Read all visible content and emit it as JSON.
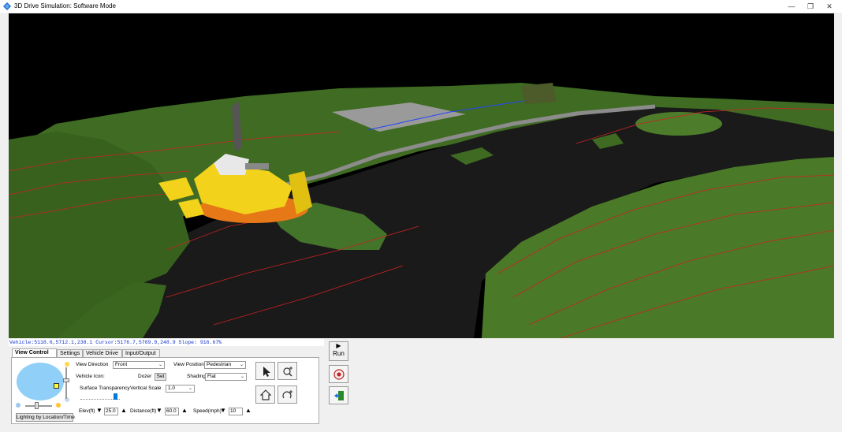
{
  "window": {
    "title": "3D Drive Simulation: Software Mode",
    "controls": {
      "minimize": "—",
      "restore": "❐",
      "close": "✕"
    }
  },
  "status": {
    "line": "Vehicle:5118.6,5712.1,238.1  Cursor:5176.7,5769.9,248.9 Slope: 916.67%"
  },
  "tabs": [
    {
      "label": "View Control",
      "active": true
    },
    {
      "label": "Settings",
      "active": false
    },
    {
      "label": "Vehicle Drive",
      "active": false
    },
    {
      "label": "Input/Output",
      "active": false
    }
  ],
  "view_control": {
    "view_direction_label": "View Direction",
    "view_direction_value": "Front",
    "view_position_label": "View Position",
    "view_position_value": "Pedestrian",
    "vehicle_icon_label": "Vehicle Icon:",
    "vehicle_icon_value": "Dozer",
    "set_button": "Set",
    "shading_label": "Shading",
    "shading_value": "Flat",
    "surface_transparency_label": "Surface Transparency",
    "vertical_scale_label": "Vertical Scale",
    "vertical_scale_value": "1.0",
    "lighting_button": "Lighting by Location/Time",
    "elev_label": "Elev(ft)",
    "elev_value": "25.0",
    "distance_label": "Distance(ft)",
    "distance_value": "60.0",
    "speed_label": "Speed(mph)",
    "speed_value": "10"
  },
  "run_button": {
    "arrow": "▶",
    "label": "Run"
  },
  "icons": {
    "app": "app-icon",
    "select": "cursor-arrow-icon",
    "zoom_in": "zoom-plus-icon",
    "home_view": "home-view-icon",
    "rotate_view": "rotate-zoom-icon",
    "help": "help-icon",
    "exit": "exit-door-icon"
  },
  "colors": {
    "terrain_dark": "#1a1a1a",
    "grass": "#3f6b22",
    "contour": "#cc2222",
    "dozer": "#f2d21a",
    "status_text": "#1133cc"
  }
}
